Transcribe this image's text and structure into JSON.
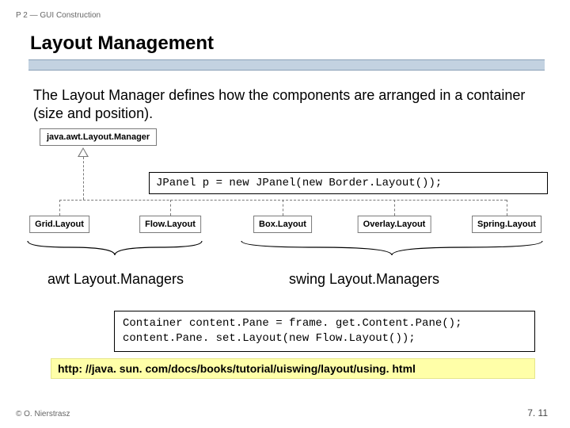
{
  "header": {
    "breadcrumb": "P 2 — GUI Construction"
  },
  "title": "Layout Management",
  "description": "The Layout Manager defines how the components are arranged in a container (size and position).",
  "diagram": {
    "root": "java.awt.Layout.Manager",
    "leaves": [
      "Grid.Layout",
      "Flow.Layout",
      "Box.Layout",
      "Overlay.Layout",
      "Spring.Layout"
    ],
    "code_top": "JPanel  p = new JPanel(new Border.Layout());",
    "group_awt": "awt Layout.Managers",
    "group_swing": "swing Layout.Managers"
  },
  "code_bottom": {
    "line1": "Container content.Pane = frame. get.Content.Pane();",
    "line2": "content.Pane. set.Layout(new Flow.Layout());"
  },
  "link": "http: //java. sun. com/docs/books/tutorial/uiswing/layout/using. html",
  "footer": {
    "copyright": "© O. Nierstrasz",
    "page": "7. 11"
  }
}
